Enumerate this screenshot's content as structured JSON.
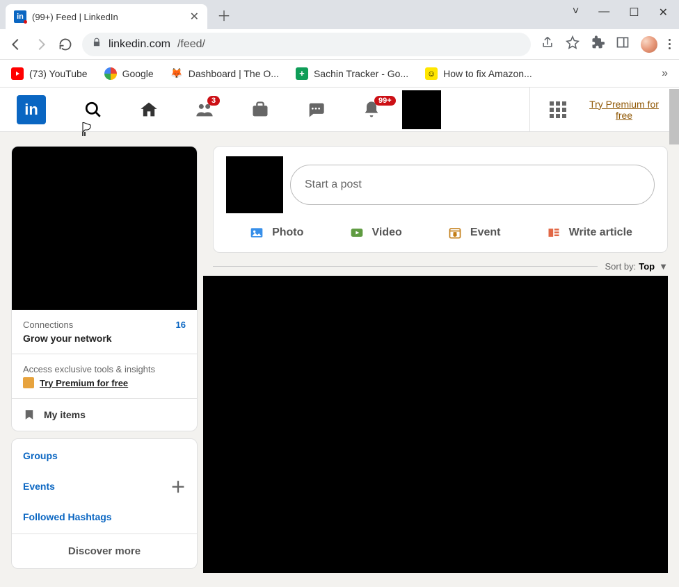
{
  "browser": {
    "tab_title": "(99+) Feed | LinkedIn",
    "url_host": "linkedin.com",
    "url_path": "/feed/"
  },
  "bookmarks": [
    {
      "label": "(73) YouTube",
      "color": "#ff0000"
    },
    {
      "label": "Google",
      "color": "#ffffff"
    },
    {
      "label": "Dashboard | The O...",
      "color": "#f4c542"
    },
    {
      "label": "Sachin Tracker - Go...",
      "color": "#0f9d58"
    },
    {
      "label": "How to fix Amazon...",
      "color": "#ffe600"
    }
  ],
  "nav": {
    "network_badge": "3",
    "notif_badge": "99+",
    "premium_text": "Try Premium for free"
  },
  "sidebar": {
    "connections_label": "Connections",
    "connections_count": "16",
    "grow_text": "Grow your network",
    "exclusive_text": "Access exclusive tools & insights",
    "premium_text": "Try Premium for free",
    "my_items": "My items",
    "links": [
      "Groups",
      "Events",
      "Followed Hashtags"
    ],
    "discover": "Discover more"
  },
  "post": {
    "placeholder": "Start a post",
    "actions": [
      {
        "label": "Photo",
        "color": "#378fe9"
      },
      {
        "label": "Video",
        "color": "#5f9b41"
      },
      {
        "label": "Event",
        "color": "#c37d16"
      },
      {
        "label": "Write article",
        "color": "#e16745"
      }
    ]
  },
  "sort": {
    "label": "Sort by:",
    "value": "Top"
  }
}
